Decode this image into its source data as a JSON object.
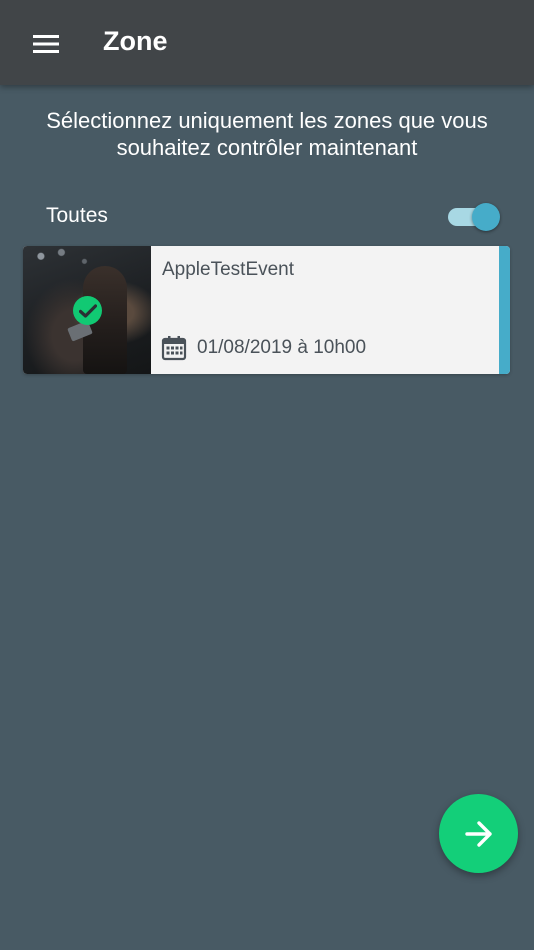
{
  "appbar": {
    "title": "Zone",
    "menu_icon": "hamburger-menu-icon"
  },
  "instruction": "Sélectionnez uniquement les zones que vous souhaitez contrôler maintenant",
  "select_all": {
    "label": "Toutes",
    "checked": true
  },
  "events": [
    {
      "name": "AppleTestEvent",
      "date": "01/08/2019 à 10h00",
      "selected": true,
      "date_icon": "calendar-icon",
      "selected_icon": "check-circle-icon"
    }
  ],
  "fab": {
    "icon": "arrow-right-icon"
  },
  "colors": {
    "background": "#485a64",
    "appbar": "#414548",
    "accent": "#46acc9",
    "toggle_track": "#a8d8e4",
    "success": "#13cf79",
    "card_bg": "#f3f3f3",
    "card_text": "#4a5259"
  }
}
